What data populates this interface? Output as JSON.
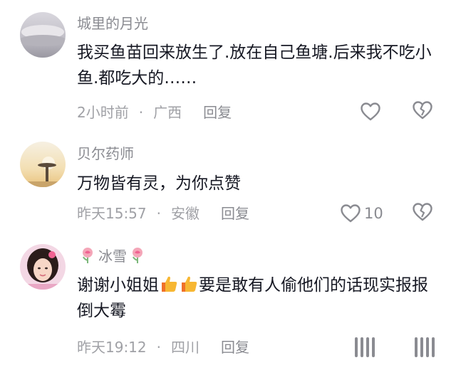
{
  "comments": [
    {
      "username": "城里的月光",
      "text": "我买鱼苗回来放生了.放在自己鱼塘.后来我不吃小鱼.都吃大的……",
      "time": "2小时前",
      "location": "广西",
      "reply_label": "回复",
      "like_count": "",
      "avatar_icon": "cloud-sky-avatar"
    },
    {
      "username": "贝尔药师",
      "text": "万物皆有灵，为你点赞",
      "time": "昨天15:57",
      "location": "安徽",
      "reply_label": "回复",
      "like_count": "10",
      "avatar_icon": "sunset-tower-avatar"
    },
    {
      "username": "冰雪",
      "name_decoration": "rose-emoji",
      "text_part1": "谢谢小姐姐",
      "text_emoji": "thumbs-up-emoji",
      "text_part2": "要是敢有人偷他们的话现实报报倒大霉",
      "time": "昨天19:12",
      "location": "四川",
      "reply_label": "回复",
      "like_count": "",
      "avatar_icon": "girl-portrait-avatar"
    }
  ],
  "separator": "·",
  "colors": {
    "primary_text": "#161823",
    "secondary_text": "#8a8b91",
    "meta_text": "#a0a1a6",
    "thumbs_yellow": "#f7b733",
    "thumbs_orange": "#f0712a",
    "rose_pink": "#f06292"
  }
}
